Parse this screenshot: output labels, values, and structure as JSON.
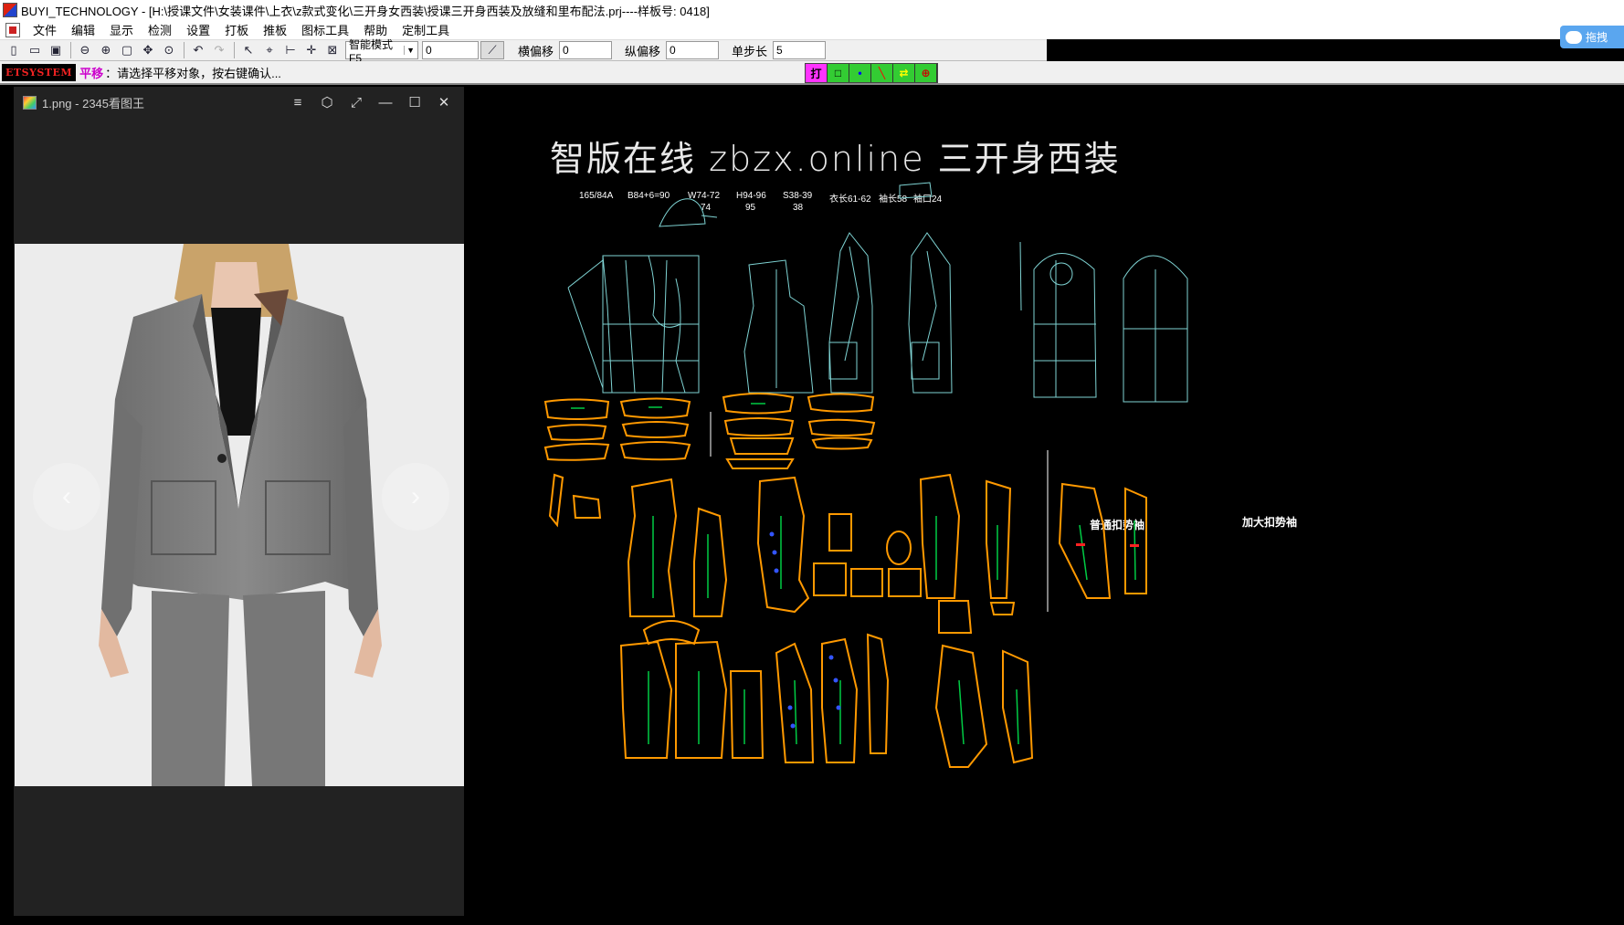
{
  "window": {
    "title": "BUYI_TECHNOLOGY - [H:\\授课文件\\女装课件\\上衣\\z款式变化\\三开身女西装\\授课三开身西装及放缝和里布配法.prj----样板号: 0418]"
  },
  "menu": {
    "items": [
      "文件",
      "编辑",
      "显示",
      "检测",
      "设置",
      "打板",
      "推板",
      "图标工具",
      "帮助",
      "定制工具"
    ]
  },
  "toolbar": {
    "mode_select": "智能模式F5",
    "value_field": "0",
    "h_offset_label": "横偏移",
    "h_offset_value": "0",
    "v_offset_label": "纵偏移",
    "v_offset_value": "0",
    "step_label": "单步长",
    "step_value": "5",
    "icons": [
      "new-icon",
      "open-icon",
      "save-icon",
      "zoom-out-icon",
      "zoom-in-icon",
      "window-zoom-icon",
      "pan-icon",
      "zoom-fit-icon",
      "undo-icon",
      "redo-icon",
      "select-delete-icon",
      "point-tool-icon",
      "measure-icon",
      "add-point-icon",
      "delete-point-icon"
    ]
  },
  "status": {
    "logo": "ETSYSTEM",
    "command": "平移",
    "message": "：请选择平移对象，按右键确认..."
  },
  "color_tools": [
    {
      "label": "打",
      "bg": "#ff33ff",
      "fg": "#000000"
    },
    {
      "label": "□",
      "bg": "#33cc33",
      "fg": "#000000"
    },
    {
      "label": "•",
      "bg": "#33cc33",
      "fg": "#0000ff"
    },
    {
      "label": "╲",
      "bg": "#33cc33",
      "fg": "#ff0000"
    },
    {
      "label": "⇄",
      "bg": "#33cc33",
      "fg": "#ffff00"
    },
    {
      "label": "⊕",
      "bg": "#33cc33",
      "fg": "#cc0000"
    }
  ],
  "cloud_widget": {
    "label": "拖拽"
  },
  "viewer": {
    "title": "1.png - 2345看图王",
    "controls": [
      "≡",
      "⬡",
      "⤢",
      "—",
      "☐",
      "✕"
    ],
    "prev": "‹",
    "next": "›"
  },
  "canvas": {
    "title": "智版在线   zbzx.online   三开身西装",
    "specs": [
      {
        "text": "165/84A"
      },
      {
        "text": "B84+6=90"
      },
      {
        "text": "W74-72"
      },
      {
        "text": "74"
      },
      {
        "text": "H94-96"
      },
      {
        "text": "95"
      },
      {
        "text": "S38-39"
      },
      {
        "text": "38"
      },
      {
        "text": "衣长61-62"
      },
      {
        "text": "袖长58"
      },
      {
        "text": "袖口24"
      }
    ],
    "sleeve_labels": [
      "普通扣势袖",
      "加大扣势袖"
    ]
  },
  "colors": {
    "pattern_line": "#7fd4d4",
    "seam_line": "#ff9900",
    "grain_line": "#00cc44",
    "marker": "#3355ff"
  }
}
